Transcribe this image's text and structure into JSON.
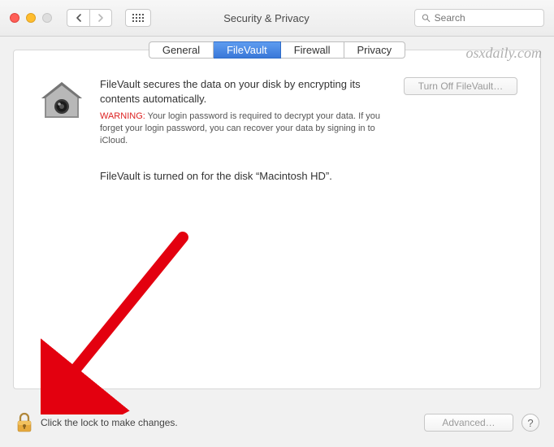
{
  "window": {
    "title": "Security & Privacy"
  },
  "search": {
    "placeholder": "Search"
  },
  "tabs": [
    {
      "label": "General"
    },
    {
      "label": "FileVault",
      "active": true
    },
    {
      "label": "Firewall"
    },
    {
      "label": "Privacy"
    }
  ],
  "main": {
    "description": "FileVault secures the data on your disk by encrypting its contents automatically.",
    "warning_label": "WARNING:",
    "warning_text": " Your login password is required to decrypt your data. If you forget your login password, you can recover your data by signing in to iCloud.",
    "turnoff_button": "Turn Off FileVault…",
    "status": "FileVault is turned on for the disk “Macintosh HD”."
  },
  "footer": {
    "lock_text": "Click the lock to make changes.",
    "advanced_button": "Advanced…",
    "help_label": "?"
  },
  "watermark": "osxdaily.com"
}
